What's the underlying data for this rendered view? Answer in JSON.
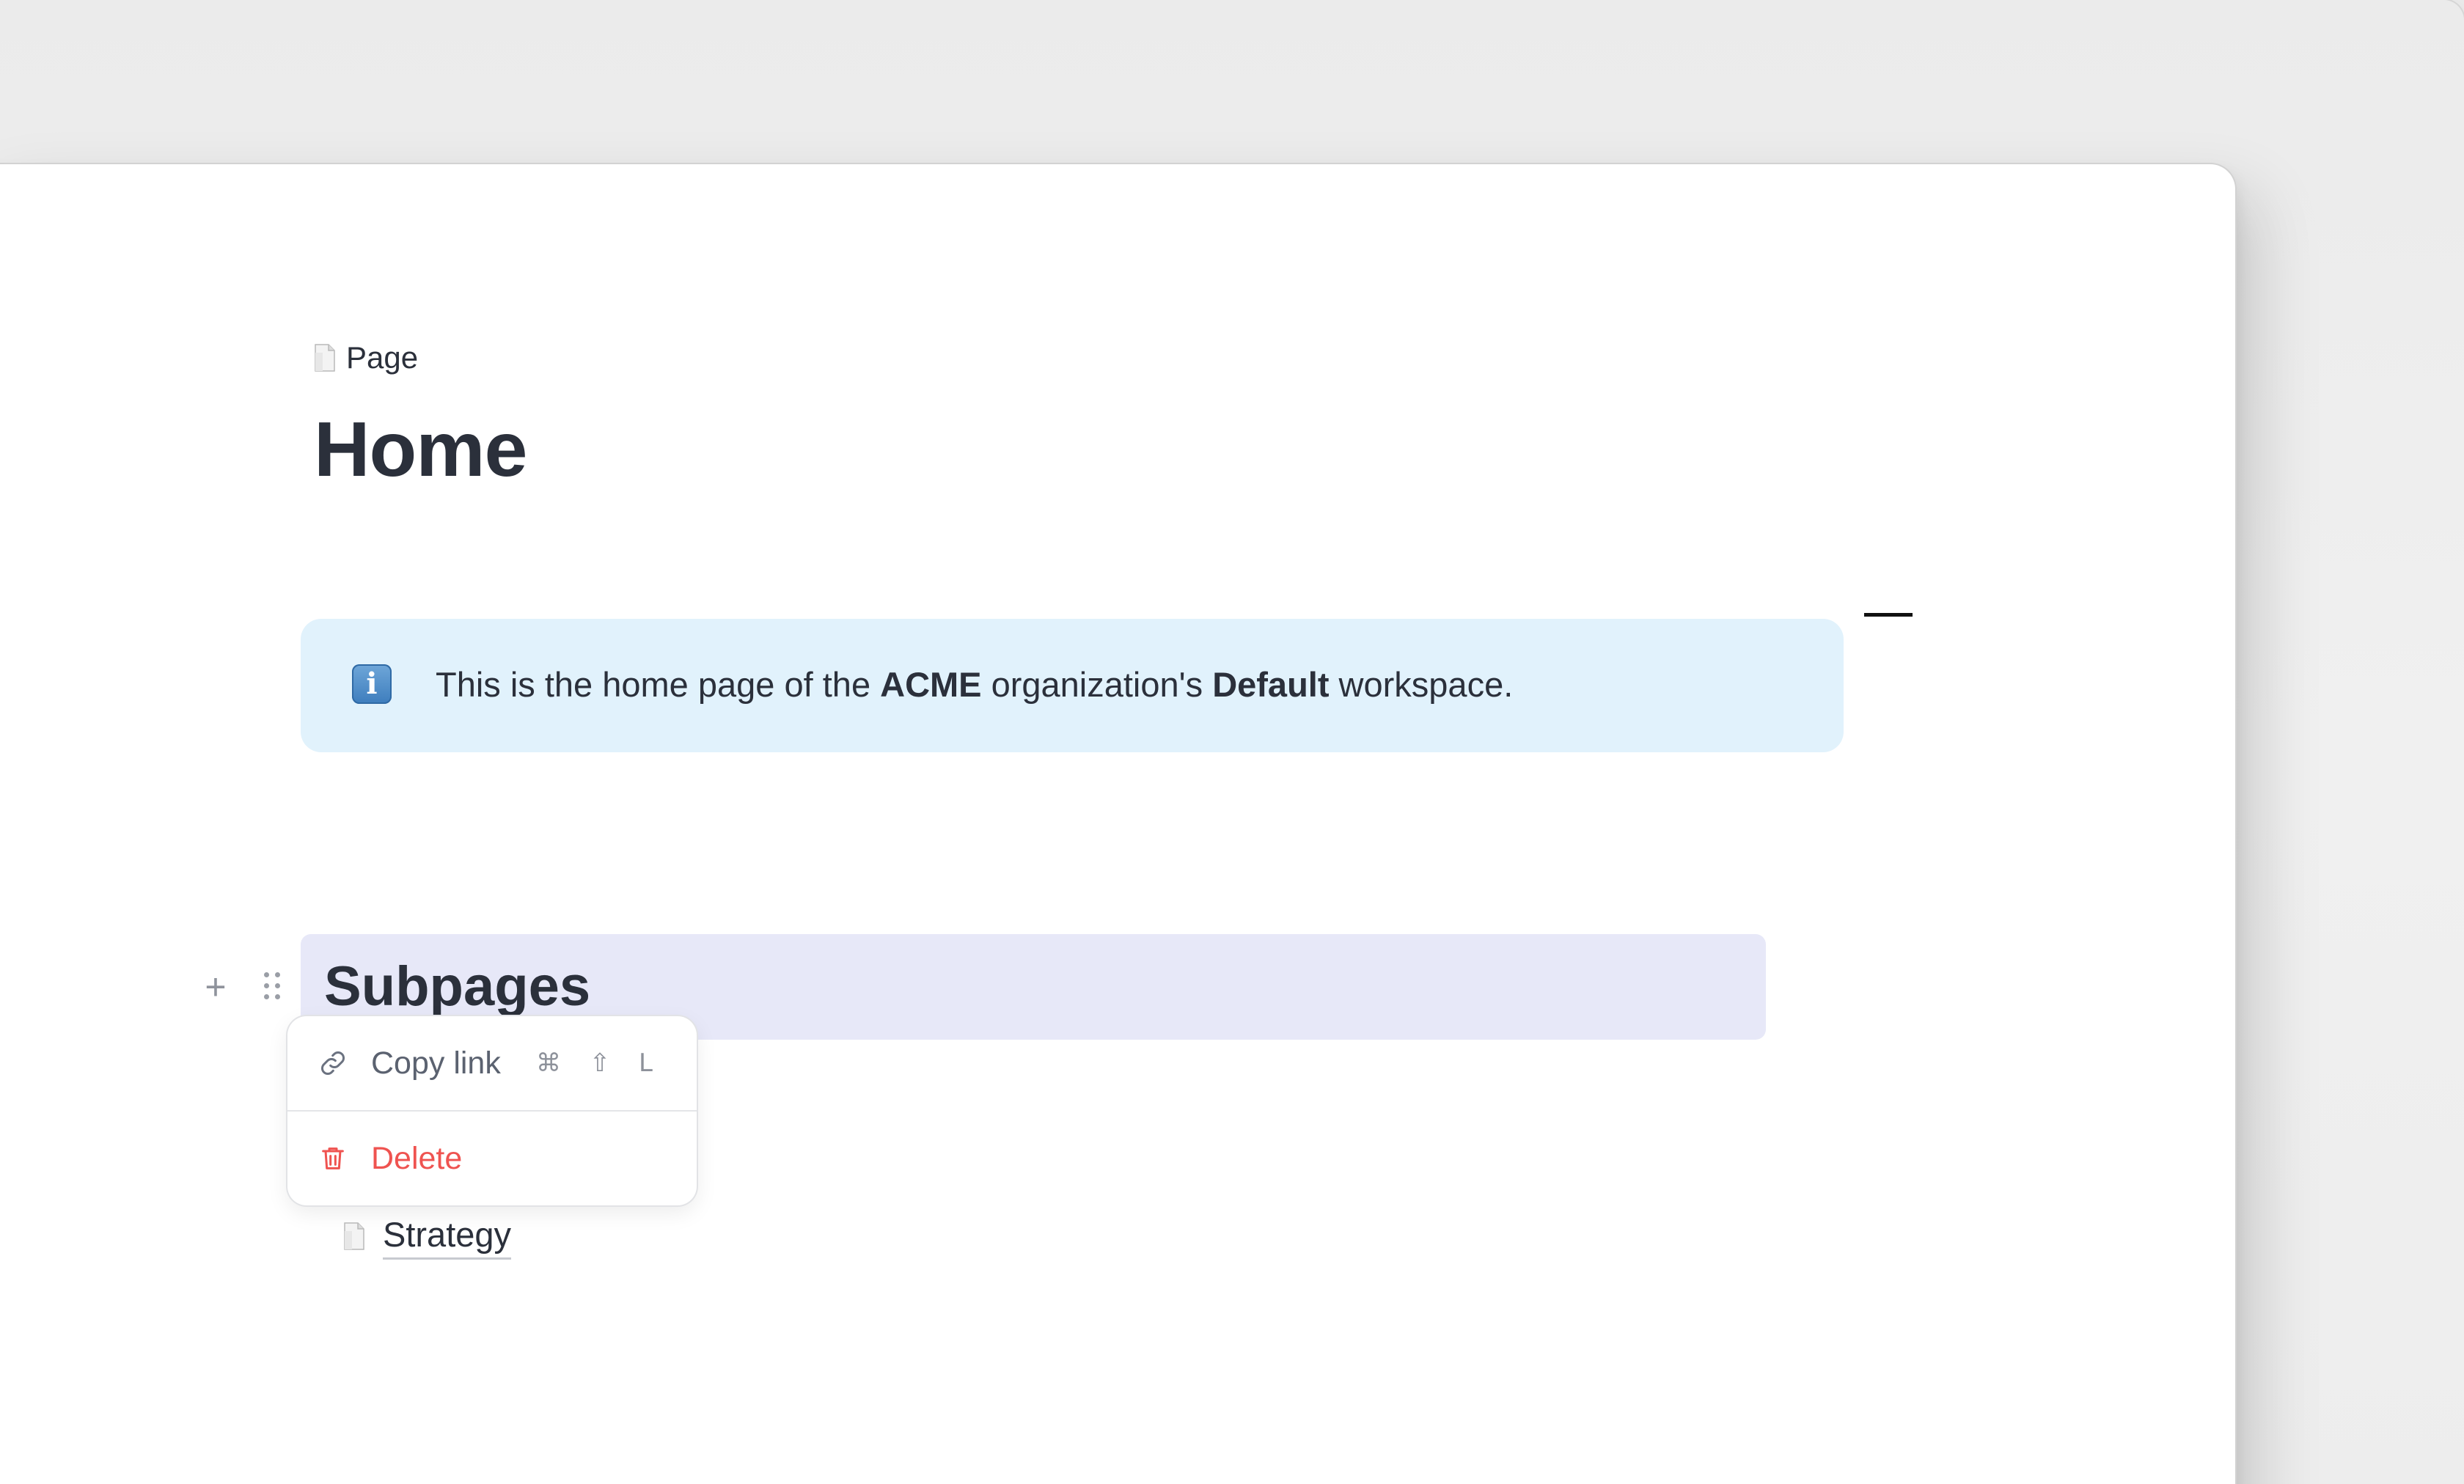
{
  "breadcrumb": {
    "icon": "page-icon",
    "label": "Page"
  },
  "page": {
    "title": "Home"
  },
  "callout": {
    "icon": "info-icon",
    "icon_glyph": "i",
    "text_before": "This is the home page of the ",
    "org": "ACME",
    "text_middle": " organization's ",
    "workspace": "Default",
    "text_after": " workspace."
  },
  "heading_block": {
    "text": "Subpages"
  },
  "block_controls": {
    "plus_glyph": "+",
    "drag_icon": "drag-handle-icon"
  },
  "context_menu": {
    "copy_link": {
      "label": "Copy link",
      "icon": "link-icon",
      "shortcut": "⌘ ⇧ L"
    },
    "delete": {
      "label": "Delete",
      "icon": "trash-icon",
      "color": "#ef5350"
    }
  },
  "subpages": [
    {
      "label": "Strategy",
      "icon": "page-icon"
    }
  ],
  "colors": {
    "callout_bg": "#e1f2fc",
    "heading_highlight": "#e7e8f8",
    "text": "#2b303b",
    "danger": "#ef5350"
  }
}
